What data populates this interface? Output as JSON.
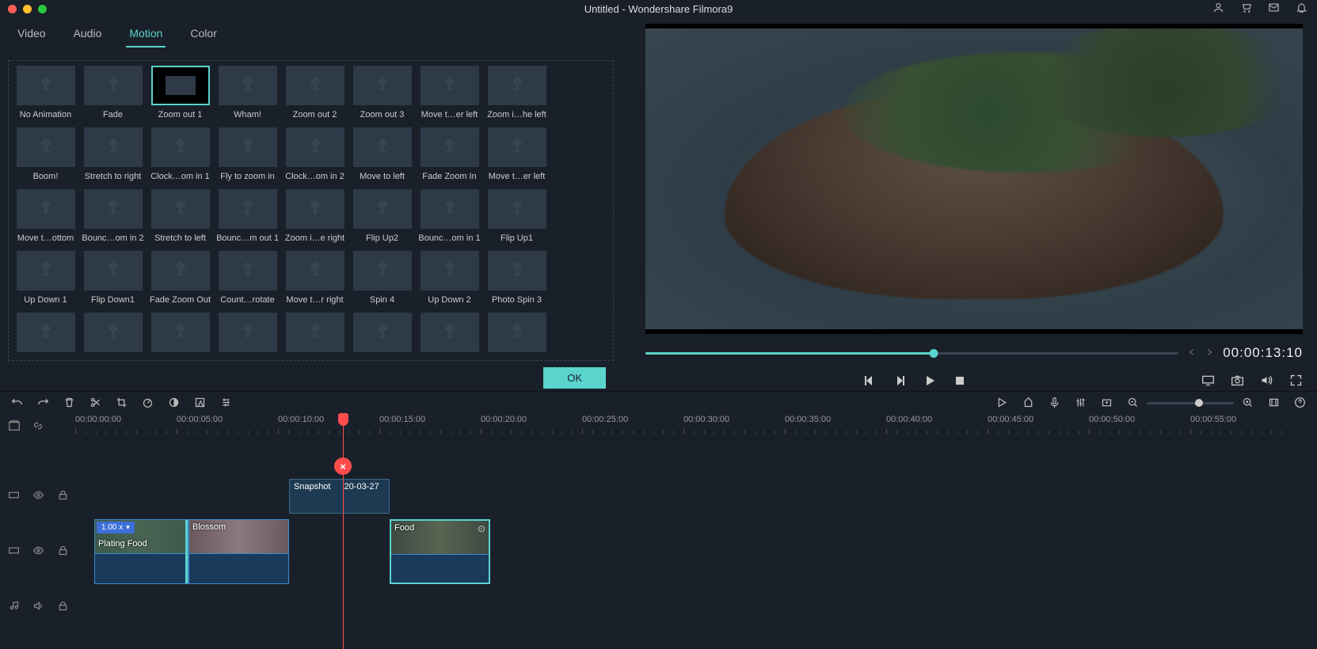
{
  "title": "Untitled - Wondershare Filmora9",
  "tabs": {
    "video": "Video",
    "audio": "Audio",
    "motion": "Motion",
    "color": "Color"
  },
  "motion_effects": [
    "No Animation",
    "Fade",
    "Zoom out 1",
    "Wham!",
    "Zoom out 2",
    "Zoom out 3",
    "Move t…er left",
    "Zoom i…he left",
    "Boom!",
    "Stretch to right",
    "Clock…om in 1",
    "Fly to zoom in",
    "Clock…om in 2",
    "Move to left",
    "Fade Zoom In",
    "Move t…er left",
    "Move t…ottom",
    "Bounc…om in 2",
    "Stretch to left",
    "Bounc…m out 1",
    "Zoom i…e right",
    "Flip Up2",
    "Bounc…om in 1",
    "Flip Up1",
    "Up Down 1",
    "Flip Down1",
    "Fade Zoom Out",
    "Count…rotate",
    "Move t…r right",
    "Spin 4",
    "Up Down 2",
    "Photo Spin 3",
    "",
    "",
    "",
    "",
    "",
    "",
    "",
    ""
  ],
  "selected_motion_index": 2,
  "ok_label": "OK",
  "preview": {
    "timecode": "00:00:13:10"
  },
  "ruler_ticks": [
    "00:00:00:00",
    "00:00:05:00",
    "00:00:10:00",
    "00:00:15:00",
    "00:00:20:00",
    "00:00:25:00",
    "00:00:30:00",
    "00:00:35:00",
    "00:00:40:00",
    "00:00:45:00",
    "00:00:50:00",
    "00:00:55:00"
  ],
  "timeline": {
    "snapshot": {
      "label": "Snapshot",
      "date": "20-03-27"
    },
    "clip1": {
      "label": "Plating Food",
      "speed": "1.00 x"
    },
    "clip2": {
      "label": "Blossom"
    },
    "clip3": {
      "label": "Food"
    }
  }
}
